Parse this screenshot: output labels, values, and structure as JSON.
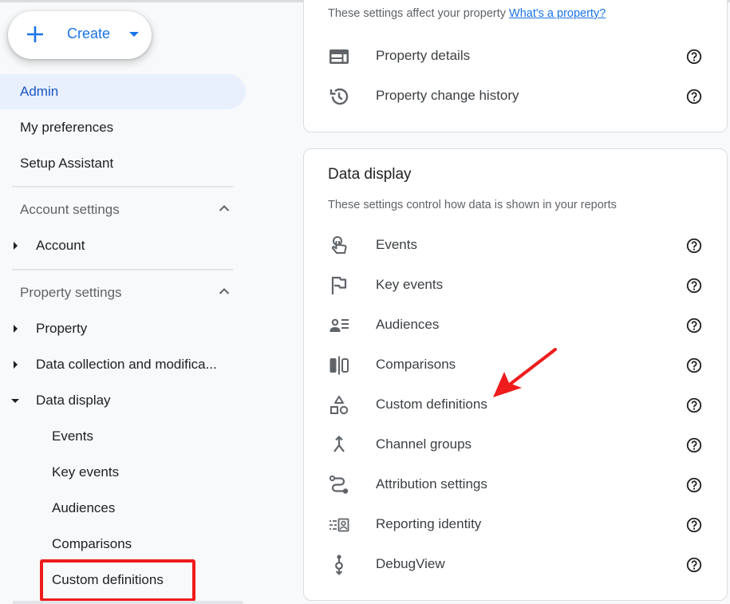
{
  "sidebar": {
    "create_button": {
      "label": "Create",
      "icon": "plus-icon",
      "dropdown_icon": "caret-down-icon"
    },
    "top_items": [
      {
        "label": "Admin",
        "active": true
      },
      {
        "label": "My preferences",
        "active": false
      },
      {
        "label": "Setup Assistant",
        "active": false
      }
    ],
    "account_settings": {
      "heading": "Account settings",
      "expanded": true,
      "items": [
        {
          "label": "Account",
          "expanded": false
        }
      ]
    },
    "property_settings": {
      "heading": "Property settings",
      "expanded": true,
      "items": [
        {
          "label": "Property",
          "expanded": false
        },
        {
          "label": "Data collection and modifica...",
          "expanded": false
        },
        {
          "label": "Data display",
          "expanded": true
        }
      ],
      "data_display_children": [
        {
          "label": "Events"
        },
        {
          "label": "Key events"
        },
        {
          "label": "Audiences"
        },
        {
          "label": "Comparisons"
        },
        {
          "label": "Custom definitions",
          "highlighted": true
        }
      ]
    }
  },
  "property_card": {
    "description": "These settings affect your property",
    "link_text": "What's a property?",
    "rows": [
      {
        "label": "Property details",
        "icon": "property-details-icon"
      },
      {
        "label": "Property change history",
        "icon": "history-icon"
      }
    ]
  },
  "data_display_card": {
    "title": "Data display",
    "description": "These settings control how data is shown in your reports",
    "rows": [
      {
        "label": "Events",
        "icon": "touch-icon"
      },
      {
        "label": "Key events",
        "icon": "flag-icon"
      },
      {
        "label": "Audiences",
        "icon": "audience-icon"
      },
      {
        "label": "Comparisons",
        "icon": "compare-icon"
      },
      {
        "label": "Custom definitions",
        "icon": "shapes-icon"
      },
      {
        "label": "Channel groups",
        "icon": "merge-icon"
      },
      {
        "label": "Attribution settings",
        "icon": "route-icon"
      },
      {
        "label": "Reporting identity",
        "icon": "reporting-identity-icon"
      },
      {
        "label": "DebugView",
        "icon": "debug-icon"
      }
    ]
  },
  "annotations": {
    "highlight_color": "#ee1c1c",
    "arrow_target": "Custom definitions"
  },
  "colors": {
    "accent": "#1a73e8",
    "active_bg": "#e8f0fe",
    "annotation_red": "#ee1c1c"
  }
}
